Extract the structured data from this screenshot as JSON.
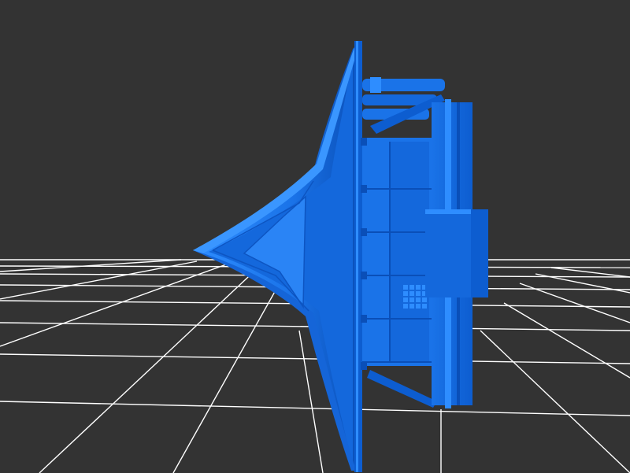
{
  "viewer": {
    "background_color": "#333333",
    "grid_color": "#ffffff",
    "model_color": "#1a73e8",
    "model_highlight_color": "#2e8dff",
    "model_shadow_color": "#0a4fb8",
    "model_dark_color": "#083f96",
    "grid_visible": true,
    "model_name_visible": false
  }
}
